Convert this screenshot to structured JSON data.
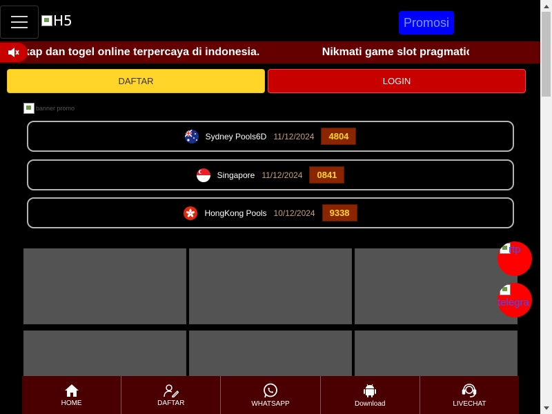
{
  "header": {
    "logo_alt": "H5",
    "promo_label": "Promosi"
  },
  "marquee": {
    "text_1": "kap dan togel online terpercaya di indonesia.",
    "text_2": "Nikmati game slot pragmatic pla"
  },
  "auth": {
    "register_label": "DAFTAR",
    "login_label": "LOGIN"
  },
  "banner": {
    "alt": "banner promo"
  },
  "results": [
    {
      "market": "Sydney Pools6D",
      "date": "11/12/2024",
      "number": "4804",
      "flag": "australia-flag-icon"
    },
    {
      "market": "Singapore",
      "date": "11/12/2024",
      "number": "0841",
      "flag": "singapore-flag-icon"
    },
    {
      "market": "HongKong Pools",
      "date": "10/12/2024",
      "number": "9338",
      "flag": "hongkong-flag-icon"
    }
  ],
  "floating": {
    "rtp_label": "rtp",
    "telegram_label": "telegra"
  },
  "bottom_nav": [
    {
      "label": "HOME",
      "icon": "home-icon"
    },
    {
      "label": "DAFTAR",
      "icon": "user-edit-icon"
    },
    {
      "label": "WHATSAPP",
      "icon": "whatsapp-icon"
    },
    {
      "label": "Download",
      "icon": "android-icon"
    },
    {
      "label": "LIVECHAT",
      "icon": "headset-icon"
    }
  ],
  "colors": {
    "marquee_bg": "#650000",
    "register_bg": "#ffd52a",
    "login_bg": "#c80000",
    "nav_bg": "#4a0000",
    "number_bg": "#8b2500",
    "number_text": "#ffd52a",
    "promo_bg": "#0000ff",
    "float_bg": "#ff0000"
  }
}
